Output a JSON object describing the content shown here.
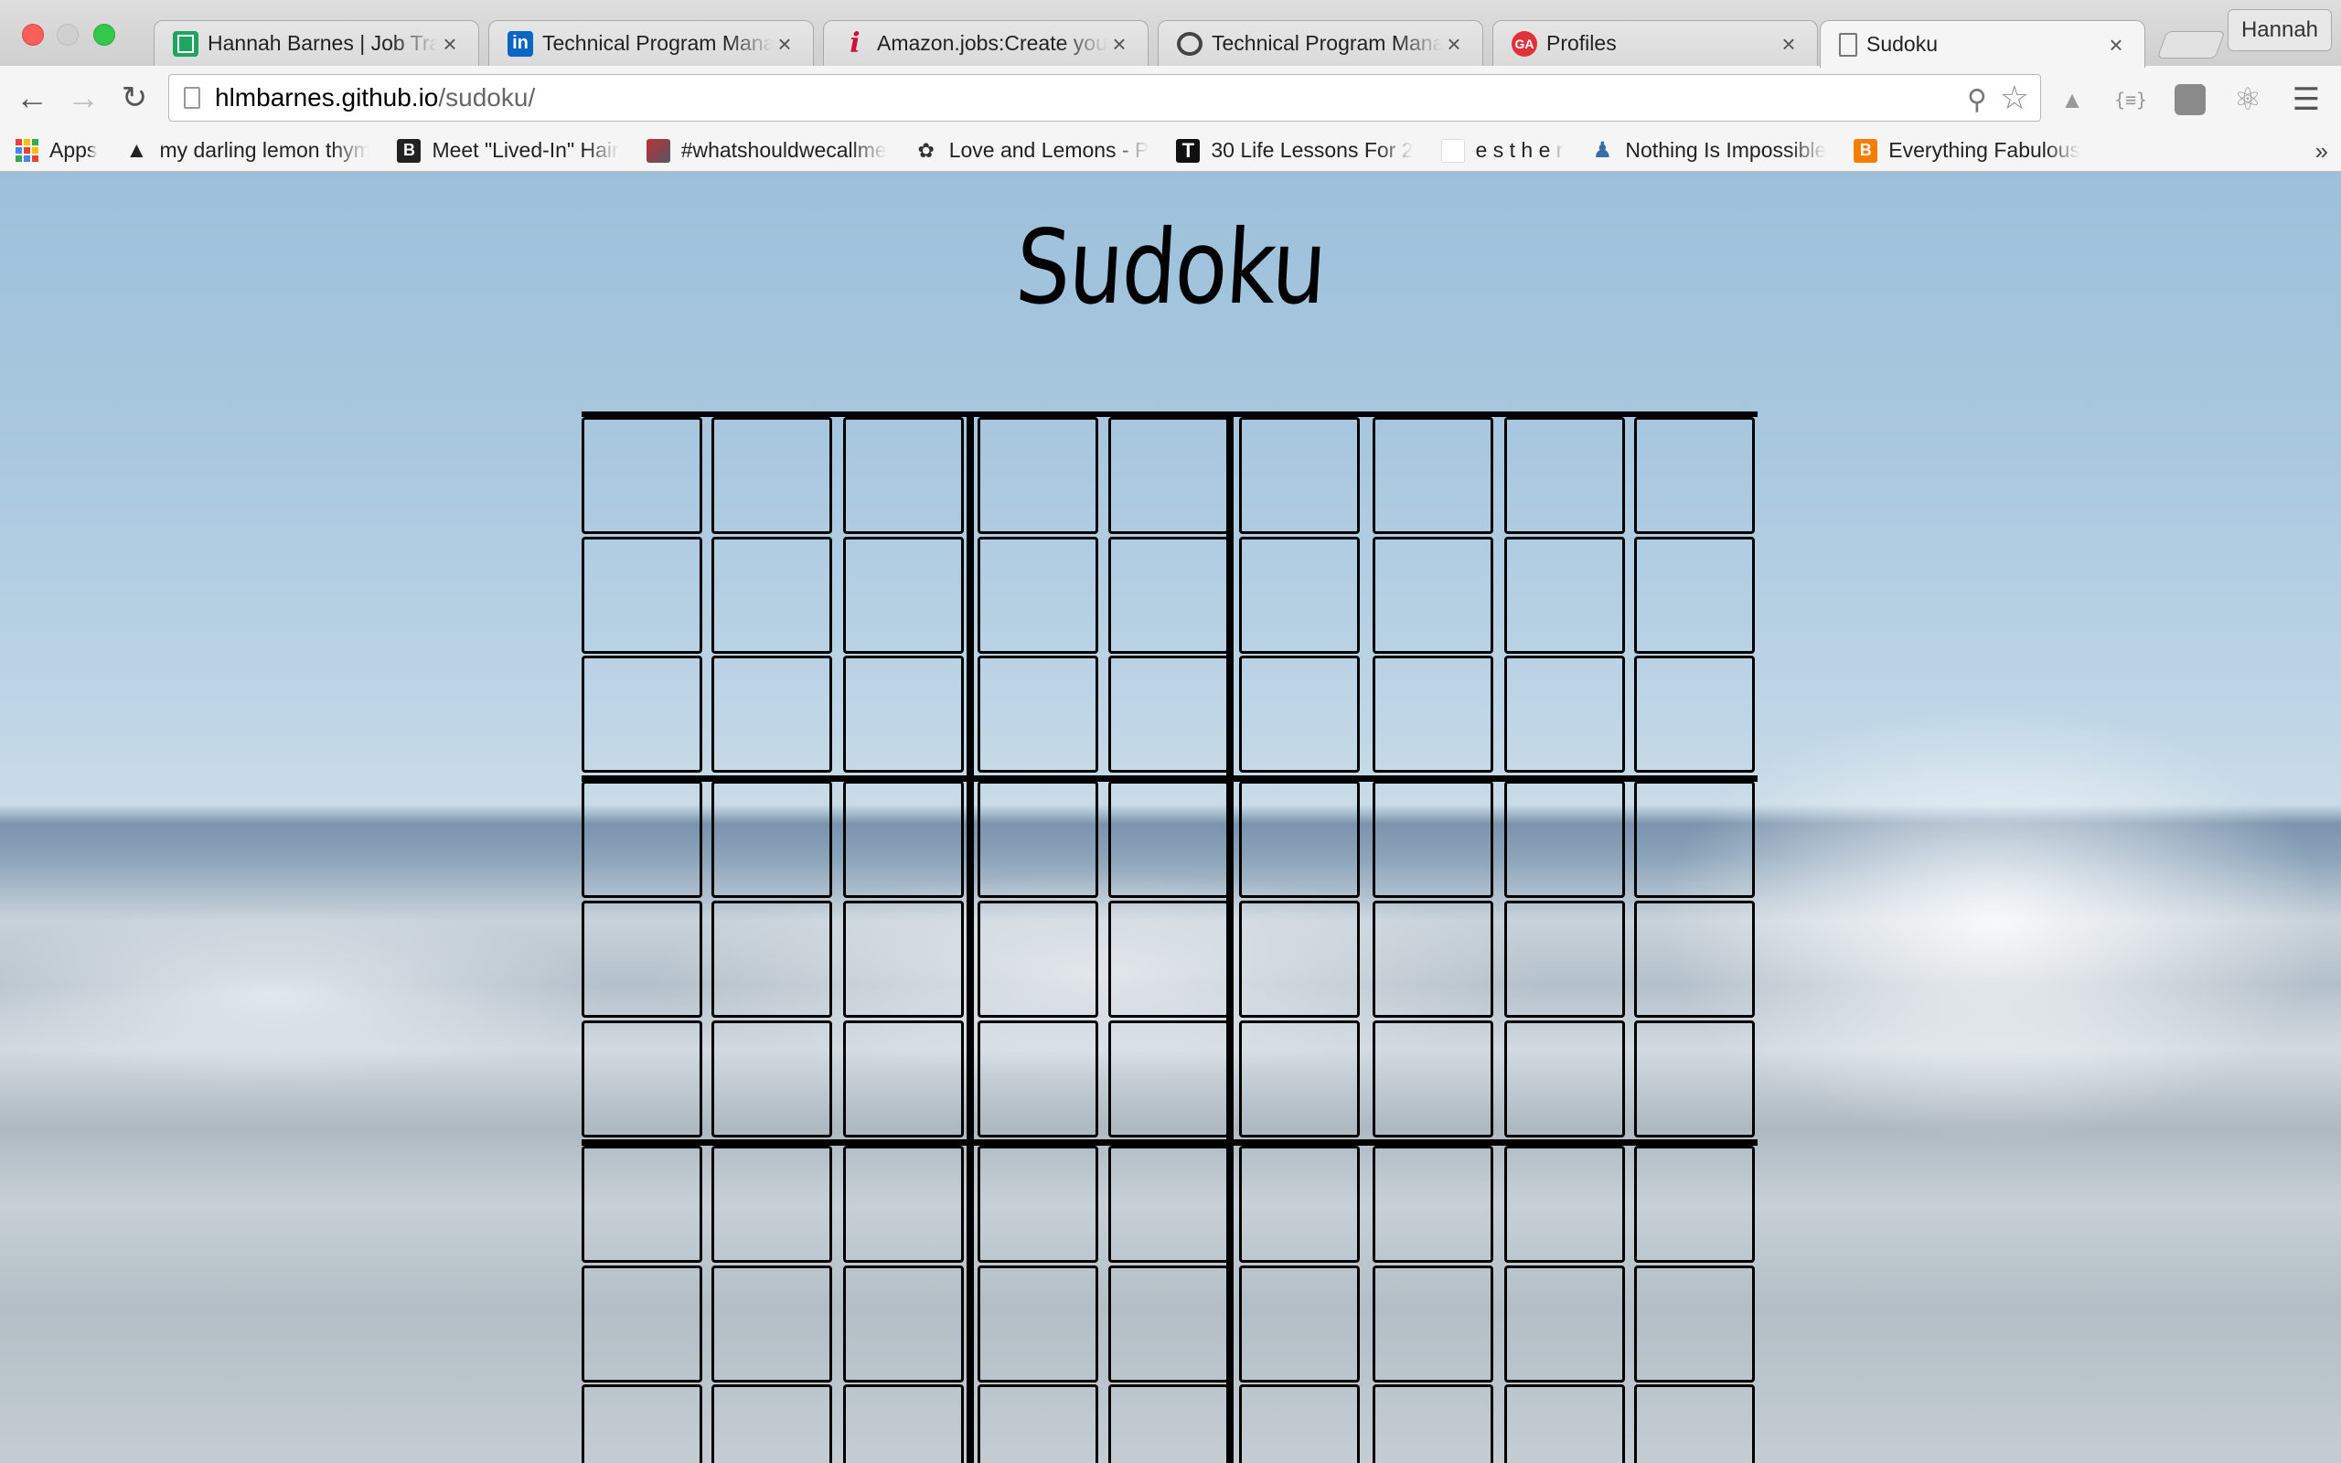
{
  "browser": {
    "tabs": [
      {
        "title": "Hannah Barnes | Job Tracker",
        "favicon": "sheets-icon"
      },
      {
        "title": "Technical Program Manager",
        "favicon": "linkedin-icon"
      },
      {
        "title": "Amazon.jobs:Create your",
        "favicon": "amazon-jobs-icon"
      },
      {
        "title": "Technical Program Manager",
        "favicon": "circle-icon"
      },
      {
        "title": "Profiles",
        "favicon": "ga-icon"
      },
      {
        "title": "Sudoku",
        "favicon": "page-icon",
        "active": true
      }
    ],
    "tab_close_glyph": "×",
    "profile_name": "Hannah",
    "address": {
      "host": "hlmbarnes.github.io",
      "path": "/sudoku/"
    },
    "bookmarks": [
      {
        "label": "Apps",
        "icon": "apps-grid-icon"
      },
      {
        "label": "my darling lemon thyme",
        "icon": "triangle-icon"
      },
      {
        "label": "Meet \"Lived-In\" Hair",
        "icon": "b-icon"
      },
      {
        "label": "#whatshouldwecallme",
        "icon": "photo-icon"
      },
      {
        "label": "Love and Lemons - P",
        "icon": "leaf-icon"
      },
      {
        "label": "30 Life Lessons For 2",
        "icon": "t-icon"
      },
      {
        "label": "e s t h e r",
        "icon": "esther-icon"
      },
      {
        "label": "Nothing Is Impossible",
        "icon": "figure-icon"
      },
      {
        "label": "Everything Fabulous",
        "icon": "blogger-icon"
      }
    ],
    "bookmarks_overflow": "»"
  },
  "page": {
    "title": "Sudoku",
    "grid_size": 9,
    "box_size": 3,
    "cells": []
  },
  "colors": {
    "sheets": "#1fa463",
    "linkedin": "#0a66c2",
    "amazon": "#d0103a",
    "ga": "#e0323b",
    "blogger": "#f57d00"
  }
}
